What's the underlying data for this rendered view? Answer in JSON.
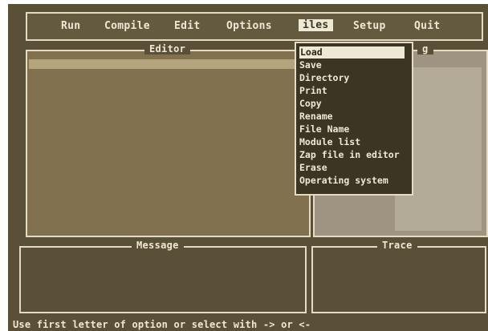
{
  "menubar": {
    "items": [
      {
        "label": "Run"
      },
      {
        "label": "Compile"
      },
      {
        "label": "Edit"
      },
      {
        "label": "Options"
      },
      {
        "label": "iles"
      },
      {
        "label": "Setup"
      },
      {
        "label": "Quit"
      }
    ]
  },
  "editor": {
    "title": "Editor"
  },
  "watch": {
    "title": "g"
  },
  "message": {
    "title": "Message"
  },
  "trace": {
    "title": "Trace"
  },
  "files_menu": {
    "items": [
      {
        "label": "Load"
      },
      {
        "label": "Save"
      },
      {
        "label": "Directory"
      },
      {
        "label": "Print"
      },
      {
        "label": "Copy"
      },
      {
        "label": "Rename"
      },
      {
        "label": "File Name"
      },
      {
        "label": "Module list"
      },
      {
        "label": "Zap file in editor"
      },
      {
        "label": "Erase"
      },
      {
        "label": "Operating system"
      }
    ]
  },
  "hint": "Use first letter of option  or  select with  ->  or  <-",
  "colors": {
    "screen": "#5a5038",
    "editor_bg": "#82714e",
    "highlight": "#efe8d4",
    "dropdown_bg": "#3c3524"
  }
}
